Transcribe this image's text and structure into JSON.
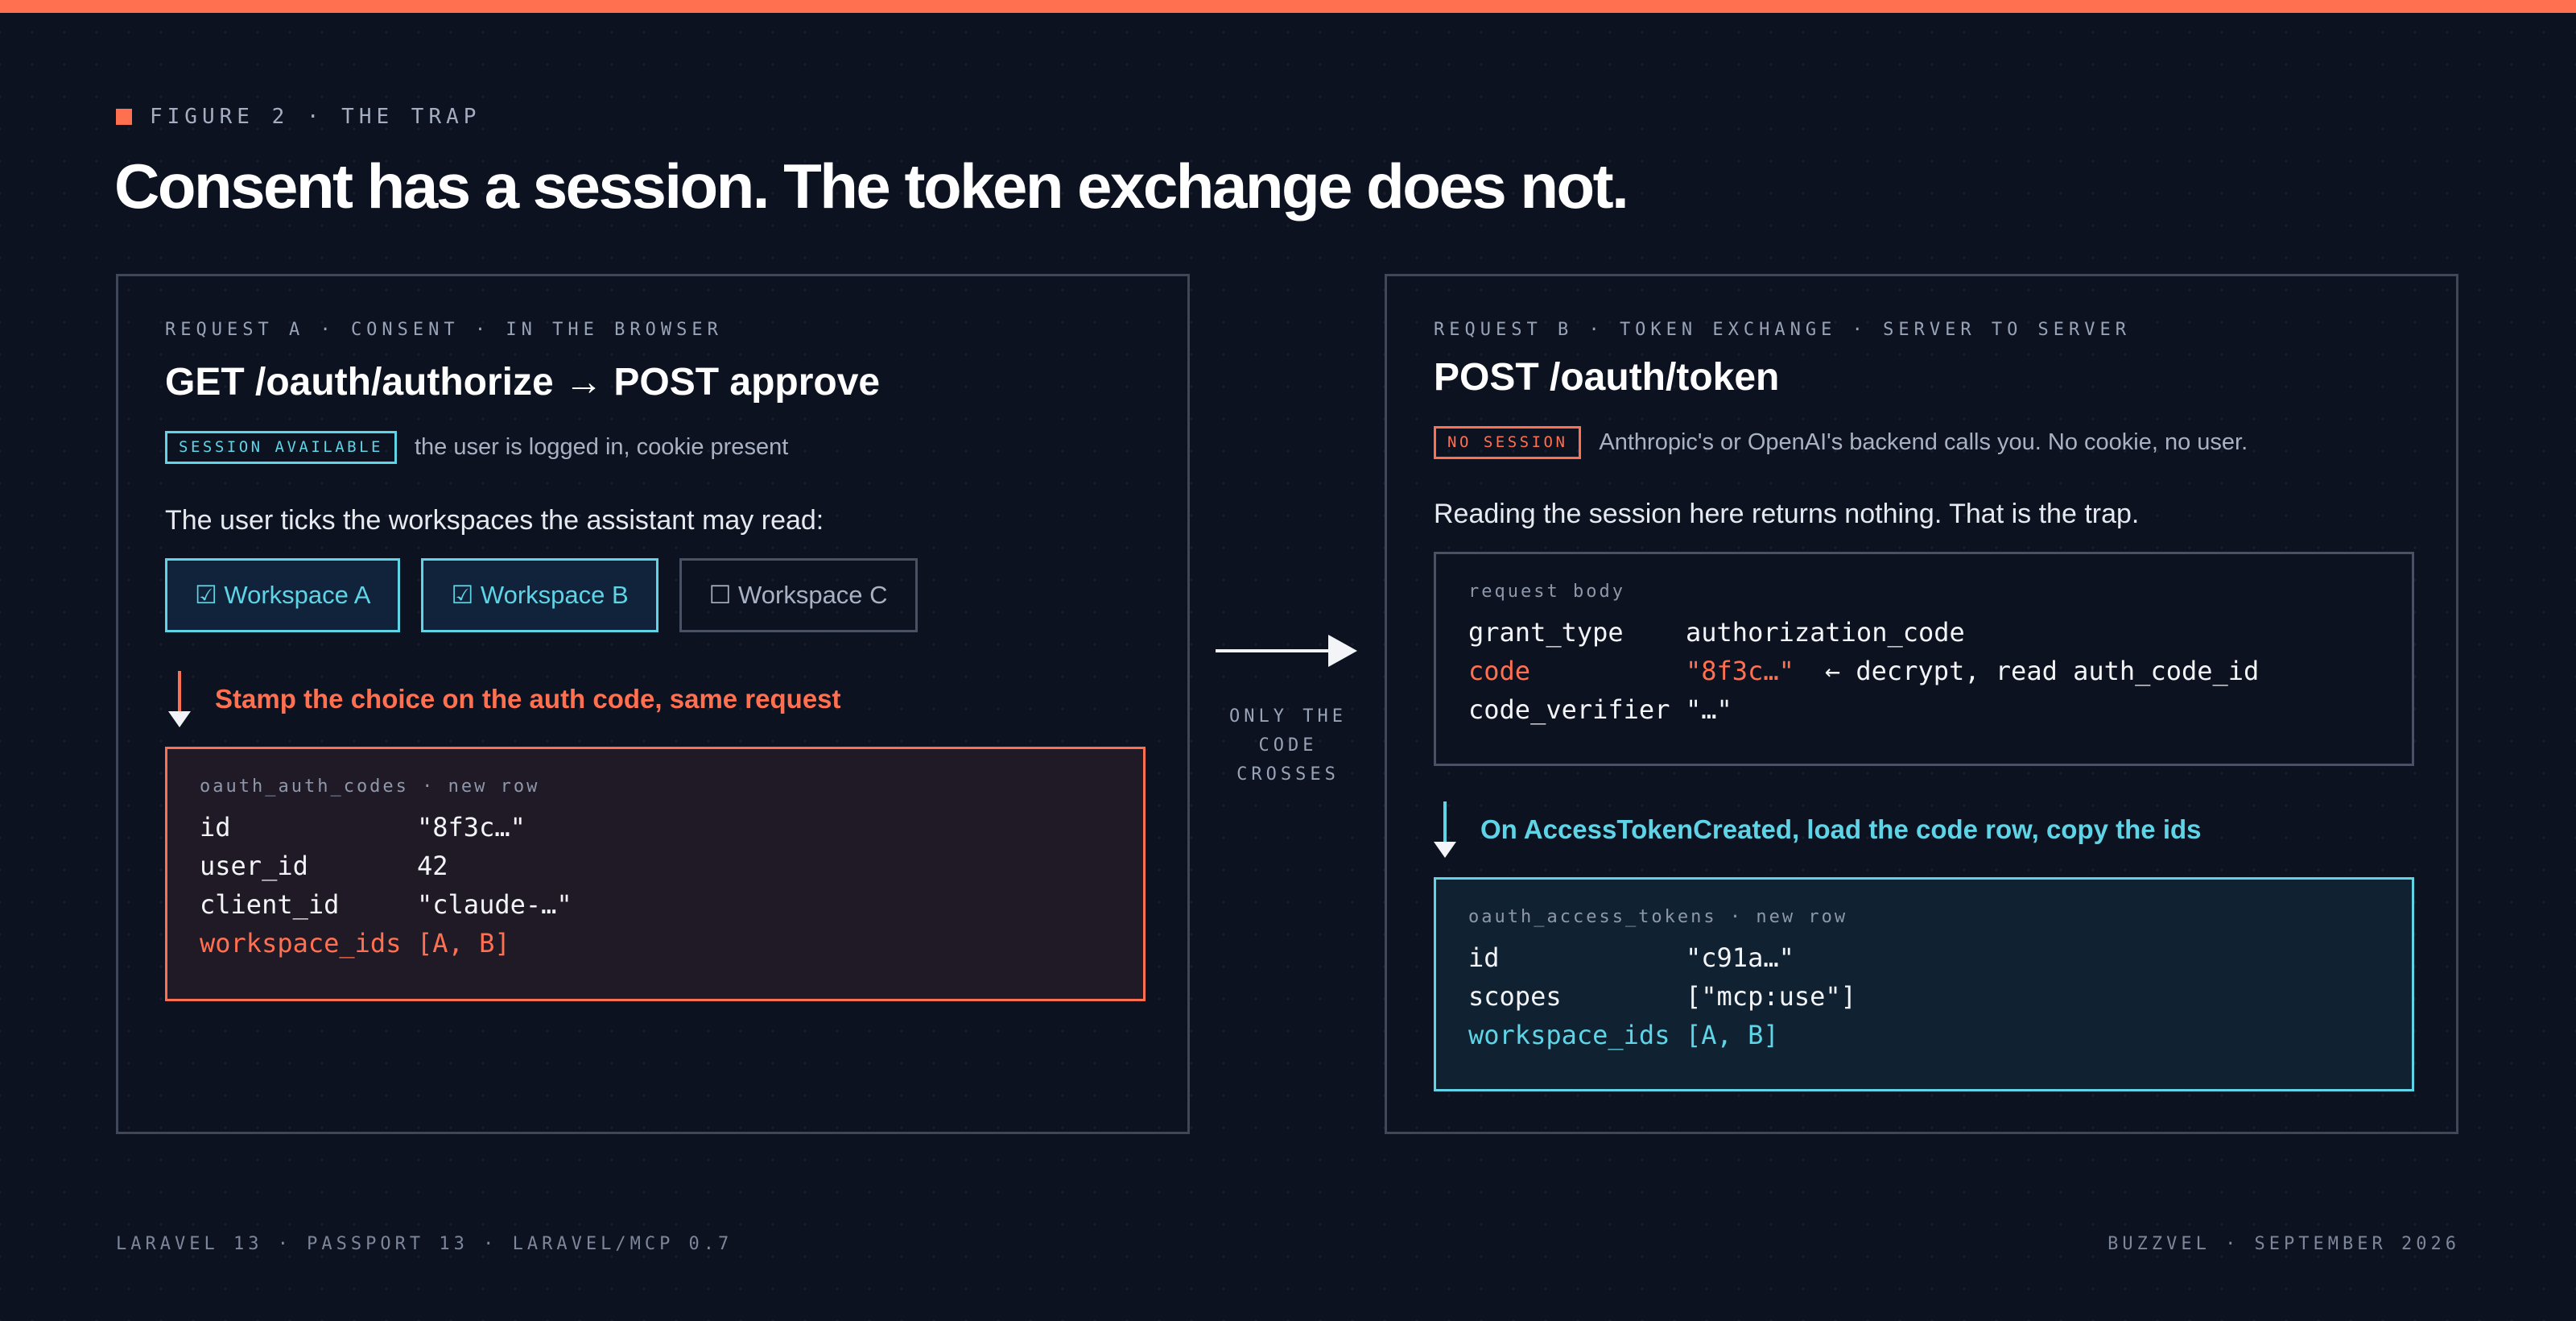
{
  "colors": {
    "accent_orange": "#ff7051",
    "accent_cyan": "#5fd4e6",
    "background": "#0d1220"
  },
  "eyebrow": "FIGURE 2 · THE TRAP",
  "title": "Consent has a session. The token exchange does not.",
  "request_a": {
    "label": "REQUEST A · CONSENT · IN THE BROWSER",
    "title": "GET /oauth/authorize → POST approve",
    "badge": "SESSION AVAILABLE",
    "status": "the user is logged in, cookie present",
    "lead": "The user ticks the workspaces the assistant may read:",
    "workspaces": [
      {
        "label": "☑ Workspace A",
        "checked": true
      },
      {
        "label": "☑ Workspace B",
        "checked": true
      },
      {
        "label": "☐ Workspace C",
        "checked": false
      }
    ],
    "step": "Stamp the choice on the auth code, same request",
    "codebox": {
      "caption": "oauth_auth_codes · new row",
      "rows": [
        {
          "key": "id",
          "value": "\"8f3c…\""
        },
        {
          "key": "user_id",
          "value": "42"
        },
        {
          "key": "client_id",
          "value": "\"claude-…\""
        },
        {
          "key": "workspace_ids",
          "value": "[A, B]"
        }
      ]
    }
  },
  "crossing": {
    "label_lines": [
      "ONLY THE",
      "CODE",
      "CROSSES"
    ]
  },
  "request_b": {
    "label": "REQUEST B · TOKEN EXCHANGE · SERVER TO SERVER",
    "title": "POST /oauth/token",
    "badge": "NO SESSION",
    "status": "Anthropic's or OpenAI's backend calls you. No cookie, no user.",
    "lead": "Reading the session here returns nothing. That is the trap.",
    "request_body": {
      "caption": "request body",
      "rows": [
        {
          "key": "grant_type",
          "value": "authorization_code",
          "note": ""
        },
        {
          "key": "code",
          "value": "\"8f3c…\"",
          "note": "← decrypt, read auth_code_id"
        },
        {
          "key": "code_verifier",
          "value": "\"…\"",
          "note": ""
        }
      ]
    },
    "step": "On AccessTokenCreated, load the code row, copy the ids",
    "codebox": {
      "caption": "oauth_access_tokens · new row",
      "rows": [
        {
          "key": "id",
          "value": "\"c91a…\""
        },
        {
          "key": "scopes",
          "value": "[\"mcp:use\"]"
        },
        {
          "key": "workspace_ids",
          "value": "[A, B]"
        }
      ]
    }
  },
  "footer": {
    "left": "LARAVEL 13 · PASSPORT 13 · LARAVEL/MCP 0.7",
    "right": "BUZZVEL · SEPTEMBER 2026"
  }
}
